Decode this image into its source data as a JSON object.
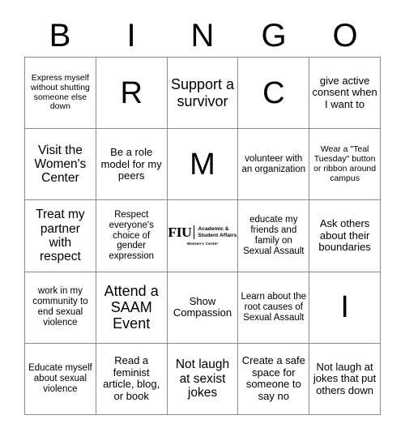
{
  "header": {
    "letters": [
      "B",
      "I",
      "N",
      "G",
      "O"
    ]
  },
  "logo": {
    "mark": "FIU",
    "dept_line1": "Academic &",
    "dept_line2": "Student Affairs",
    "sub": "Women's Center"
  },
  "grid": {
    "rows": [
      [
        {
          "text": "Express myself without shutting someone else down",
          "size": "sz-xs",
          "type": "task"
        },
        {
          "text": "R",
          "size": "sz-free",
          "type": "free-letter"
        },
        {
          "text": "Support a survivor",
          "size": "sz-xl",
          "type": "task"
        },
        {
          "text": "C",
          "size": "sz-free",
          "type": "free-letter"
        },
        {
          "text": "give active consent when I want to",
          "size": "sz-m",
          "type": "task"
        }
      ],
      [
        {
          "text": "Visit the Women's Center",
          "size": "sz-l",
          "type": "task"
        },
        {
          "text": "Be a role model for my peers",
          "size": "sz-m",
          "type": "task"
        },
        {
          "text": "M",
          "size": "sz-free",
          "type": "free-letter"
        },
        {
          "text": "volunteer with an organization",
          "size": "sz-s",
          "type": "task"
        },
        {
          "text": "Wear a \"Teal Tuesday\" button or ribbon around campus",
          "size": "sz-xs",
          "type": "task"
        }
      ],
      [
        {
          "text": "Treat my partner with respect",
          "size": "sz-l",
          "type": "task"
        },
        {
          "text": "Respect everyone's choice of gender expression",
          "size": "sz-s",
          "type": "task"
        },
        {
          "text": "",
          "size": "sz-m",
          "type": "logo"
        },
        {
          "text": "educate my friends and family on Sexual Assault",
          "size": "sz-s",
          "type": "task"
        },
        {
          "text": "Ask others about their boundaries",
          "size": "sz-m",
          "type": "task"
        }
      ],
      [
        {
          "text": "work in my community to end sexual violence",
          "size": "sz-s",
          "type": "task"
        },
        {
          "text": "Attend a SAAM Event",
          "size": "sz-xl",
          "type": "task"
        },
        {
          "text": "Show Compassion",
          "size": "sz-m",
          "type": "task"
        },
        {
          "text": "Learn about the root causes of Sexual Assault",
          "size": "sz-s",
          "type": "task"
        },
        {
          "text": "I",
          "size": "sz-free",
          "type": "free-letter"
        }
      ],
      [
        {
          "text": "Educate myself about sexual violence",
          "size": "sz-s",
          "type": "task"
        },
        {
          "text": "Read a feminist article, blog, or book",
          "size": "sz-m",
          "type": "task"
        },
        {
          "text": "Not laugh at sexist jokes",
          "size": "sz-l",
          "type": "task"
        },
        {
          "text": "Create a safe space for someone to say no",
          "size": "sz-m",
          "type": "task"
        },
        {
          "text": "Not laugh at jokes that put others down",
          "size": "sz-m",
          "type": "task"
        }
      ]
    ]
  }
}
